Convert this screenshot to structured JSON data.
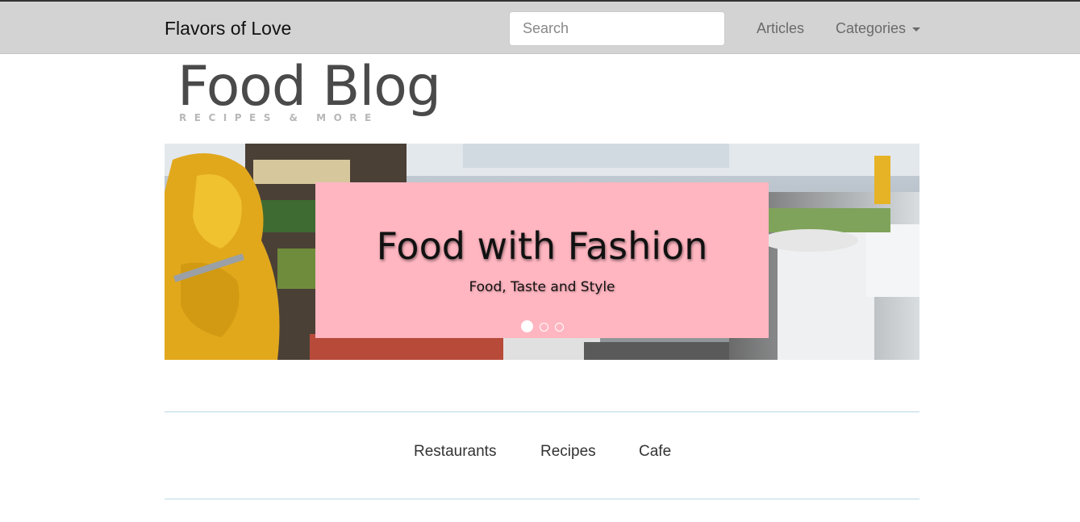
{
  "navbar": {
    "brand": "Flavors of Love",
    "search_placeholder": "Search",
    "search_value": "",
    "links": [
      {
        "label": "Articles"
      },
      {
        "label": "Categories",
        "icon": "caret-down-icon"
      }
    ]
  },
  "logo": {
    "title": "Food Blog",
    "tagline": "RECIPES & MORE"
  },
  "carousel": {
    "caption_title": "Food with Fashion",
    "caption_subtitle": "Food, Taste and Style",
    "slide_count": 3,
    "active_slide": 1,
    "caption_bg": "#ffb6c1"
  },
  "category_nav": {
    "items": [
      {
        "label": "Restaurants"
      },
      {
        "label": "Recipes"
      },
      {
        "label": "Cafe"
      }
    ]
  },
  "colors": {
    "navbar_bg": "#d3d3d3",
    "divider": "#b9d9e4"
  }
}
